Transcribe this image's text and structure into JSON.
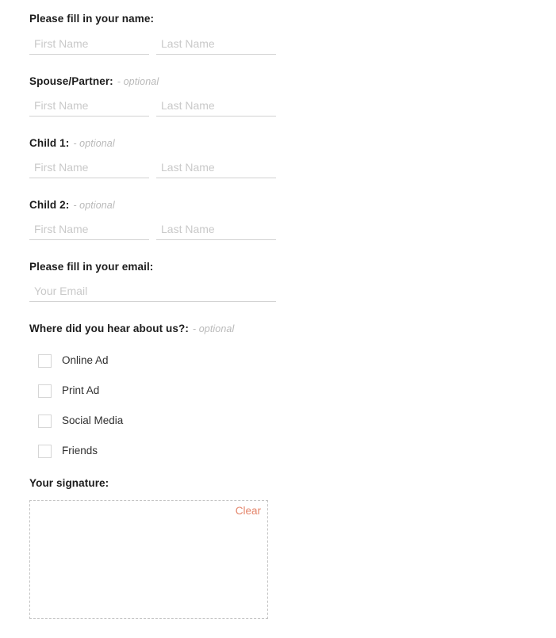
{
  "form": {
    "sections": [
      {
        "id": "name",
        "label": "Please fill in your name:",
        "optional_tag": "",
        "first_placeholder": "First Name",
        "last_placeholder": "Last Name",
        "first_value": "",
        "last_value": ""
      },
      {
        "id": "spouse",
        "label": "Spouse/Partner:",
        "optional_tag": "- optional",
        "first_placeholder": "First Name",
        "last_placeholder": "Last Name",
        "first_value": "",
        "last_value": ""
      },
      {
        "id": "child1",
        "label": "Child 1:",
        "optional_tag": "- optional",
        "first_placeholder": "First Name",
        "last_placeholder": "Last Name",
        "first_value": "",
        "last_value": ""
      },
      {
        "id": "child2",
        "label": "Child 2:",
        "optional_tag": "- optional",
        "first_placeholder": "First Name",
        "last_placeholder": "Last Name",
        "first_value": "",
        "last_value": ""
      }
    ],
    "email": {
      "label": "Please fill in your email:",
      "placeholder": "Your Email",
      "value": ""
    },
    "hear_about": {
      "label": "Where did you hear about us?:",
      "optional_tag": "- optional",
      "options": [
        {
          "label": "Online Ad",
          "checked": false
        },
        {
          "label": "Print Ad",
          "checked": false
        },
        {
          "label": "Social Media",
          "checked": false
        },
        {
          "label": "Friends",
          "checked": false
        }
      ]
    },
    "signature": {
      "label": "Your signature:",
      "clear_label": "Clear"
    }
  },
  "colors": {
    "heading": "#1c1c1c",
    "optional": "#b9b9b9",
    "placeholder": "#c9c9c9",
    "underline": "#d2d2d2",
    "checkbox_border": "#d6d6d6",
    "clear_link": "#e4856b",
    "signature_border": "#c4c4c4",
    "background": "#ffffff"
  }
}
